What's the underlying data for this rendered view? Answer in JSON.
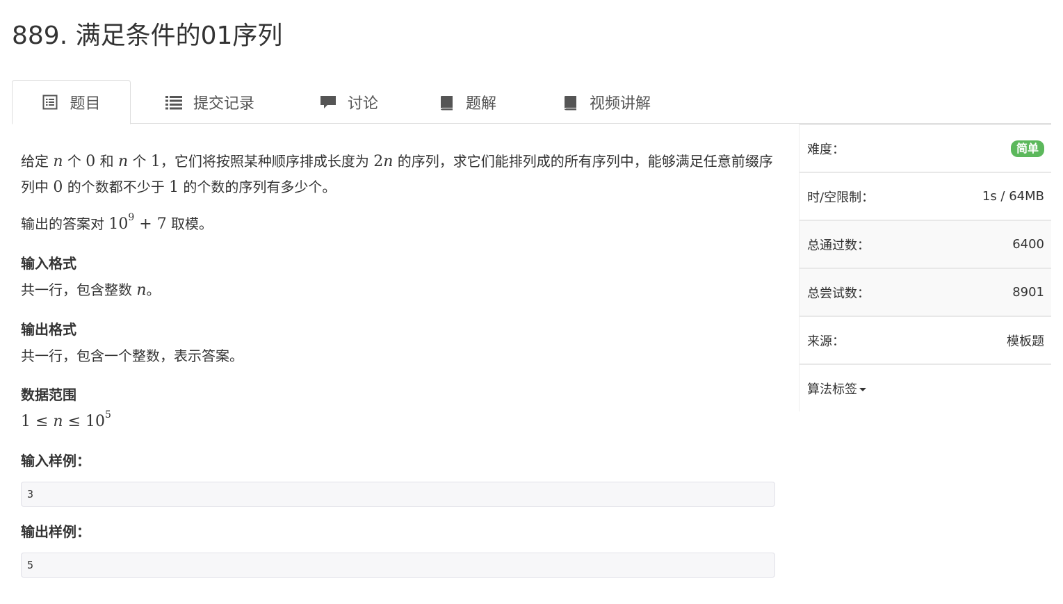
{
  "problem": {
    "title": "889. 满足条件的01序列"
  },
  "tabs": [
    {
      "label": "题目",
      "icon": "list-alt-icon",
      "active": true
    },
    {
      "label": "提交记录",
      "icon": "list-icon",
      "active": false
    },
    {
      "label": "讨论",
      "icon": "comment-icon",
      "active": false
    },
    {
      "label": "题解",
      "icon": "book-icon",
      "active": false
    },
    {
      "label": "视频讲解",
      "icon": "book-icon",
      "active": false
    }
  ],
  "description": {
    "p1_a": "给定 ",
    "p1_n1": "n",
    "p1_b": " 个 ",
    "p1_zero": "0",
    "p1_c": " 和 ",
    "p1_n2": "n",
    "p1_d": " 个 ",
    "p1_one": "1",
    "p1_e": "，它们将按照某种顺序排成长度为 ",
    "p1_2n_coef": "2",
    "p1_2n_var": "n",
    "p1_f": " 的序列，求它们能排列成的所有序列中，能够满足任意前缀序列中 ",
    "p1_zero2": "0",
    "p1_g": " 的个数都不少于 ",
    "p1_one2": "1",
    "p1_h": " 的个数的序列有多少个。",
    "p2_a": "输出的答案对 ",
    "p2_base": "10",
    "p2_exp": "9",
    "p2_plus": " + 7",
    "p2_b": " 取模。"
  },
  "input_format": {
    "heading": "输入格式",
    "text_a": "共一行，包含整数 ",
    "text_var": "n",
    "text_b": "。"
  },
  "output_format": {
    "heading": "输出格式",
    "text": "共一行，包含一个整数，表示答案。"
  },
  "data_range": {
    "heading": "数据范围",
    "lhs": "1 ≤ ",
    "var": "n",
    "mid": " ≤ ",
    "base": "10",
    "exp": "5"
  },
  "sample_input": {
    "heading": "输入样例：",
    "value": "3"
  },
  "sample_output": {
    "heading": "输出样例：",
    "value": "5"
  },
  "sidebar": {
    "difficulty_label": "难度：",
    "difficulty_value": "简单",
    "difficulty_color": "#5cb85c",
    "limit_label": "时/空限制：",
    "limit_value": "1s / 64MB",
    "passed_label": "总通过数：",
    "passed_value": "6400",
    "tried_label": "总尝试数：",
    "tried_value": "8901",
    "source_label": "来源：",
    "source_value": "模板题",
    "tags_label": "算法标签"
  }
}
